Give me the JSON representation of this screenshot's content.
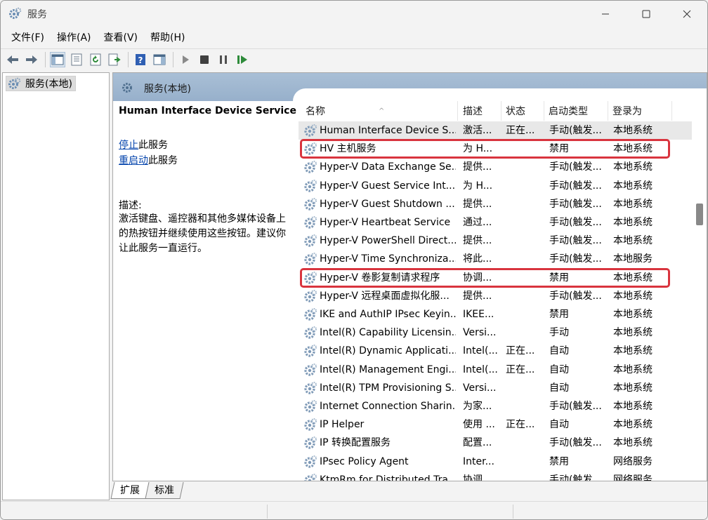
{
  "window": {
    "title": "服务"
  },
  "menu": [
    "文件(F)",
    "操作(A)",
    "查看(V)",
    "帮助(H)"
  ],
  "toolbar": {
    "icons": [
      "back-arrow-icon",
      "forward-arrow-icon",
      "show-hide-console-tree-icon",
      "properties-icon",
      "refresh-icon",
      "export-list-icon",
      "help-icon",
      "show-action-pane-icon",
      "start-service-icon",
      "stop-service-icon",
      "pause-service-icon",
      "restart-service-icon"
    ]
  },
  "tree": {
    "item_label": "服务(本地)"
  },
  "main": {
    "header_title": "服务(本地)",
    "selected_service": "Human Interface Device Service",
    "stop_link": "停止",
    "stop_suffix": "此服务",
    "restart_link": "重启动",
    "restart_suffix": "此服务",
    "desc_label": "描述:",
    "desc_text": "激活键盘、遥控器和其他多媒体设备上的热按钮并继续使用这些按钮。建议你让此服务一直运行。"
  },
  "table": {
    "columns": [
      "名称",
      "描述",
      "状态",
      "启动类型",
      "登录为"
    ],
    "rows": [
      {
        "name": "Human Interface Device S...",
        "desc": "激活...",
        "status": "正在...",
        "startup": "手动(触发...",
        "logon": "本地系统",
        "selected": true
      },
      {
        "name": "HV 主机服务",
        "desc": "为 H...",
        "status": "",
        "startup": "禁用",
        "logon": "本地系统",
        "highlight": true
      },
      {
        "name": "Hyper-V Data Exchange Se...",
        "desc": "提供...",
        "status": "",
        "startup": "手动(触发...",
        "logon": "本地系统"
      },
      {
        "name": "Hyper-V Guest Service Int...",
        "desc": "为 H...",
        "status": "",
        "startup": "手动(触发...",
        "logon": "本地系统"
      },
      {
        "name": "Hyper-V Guest Shutdown ...",
        "desc": "提供...",
        "status": "",
        "startup": "手动(触发...",
        "logon": "本地系统"
      },
      {
        "name": "Hyper-V Heartbeat Service",
        "desc": "通过...",
        "status": "",
        "startup": "手动(触发...",
        "logon": "本地系统"
      },
      {
        "name": "Hyper-V PowerShell Direct...",
        "desc": "提供...",
        "status": "",
        "startup": "手动(触发...",
        "logon": "本地系统"
      },
      {
        "name": "Hyper-V Time Synchroniza...",
        "desc": "将此...",
        "status": "",
        "startup": "手动(触发...",
        "logon": "本地服务"
      },
      {
        "name": "Hyper-V 卷影复制请求程序",
        "desc": "协调...",
        "status": "",
        "startup": "禁用",
        "logon": "本地系统",
        "highlight": true
      },
      {
        "name": "Hyper-V 远程桌面虚拟化服...",
        "desc": "提供...",
        "status": "",
        "startup": "手动(触发...",
        "logon": "本地系统"
      },
      {
        "name": "IKE and AuthIP IPsec Keyin...",
        "desc": "IKEE...",
        "status": "",
        "startup": "禁用",
        "logon": "本地系统"
      },
      {
        "name": "Intel(R) Capability Licensin...",
        "desc": "Versi...",
        "status": "",
        "startup": "手动",
        "logon": "本地系统"
      },
      {
        "name": "Intel(R) Dynamic Applicati...",
        "desc": "Intel(...",
        "status": "正在...",
        "startup": "自动",
        "logon": "本地系统"
      },
      {
        "name": "Intel(R) Management Engi...",
        "desc": "Intel(...",
        "status": "正在...",
        "startup": "自动",
        "logon": "本地系统"
      },
      {
        "name": "Intel(R) TPM Provisioning S...",
        "desc": "Versi...",
        "status": "",
        "startup": "自动",
        "logon": "本地系统"
      },
      {
        "name": "Internet Connection Sharin...",
        "desc": "为家...",
        "status": "",
        "startup": "手动(触发...",
        "logon": "本地系统"
      },
      {
        "name": "IP Helper",
        "desc": "使用 ...",
        "status": "正在...",
        "startup": "自动",
        "logon": "本地系统"
      },
      {
        "name": "IP 转换配置服务",
        "desc": "配置...",
        "status": "",
        "startup": "手动(触发...",
        "logon": "本地系统"
      },
      {
        "name": "IPsec Policy Agent",
        "desc": "Inter...",
        "status": "",
        "startup": "禁用",
        "logon": "网络服务"
      },
      {
        "name": "KtmRm for Distributed Tra...",
        "desc": "协调...",
        "status": "",
        "startup": "手动(触发...",
        "logon": "网络服务"
      }
    ]
  },
  "tabs": [
    "扩展",
    "标准"
  ],
  "colors": {
    "highlight": "#d9343e",
    "header_bg": "#a9bfd6",
    "link": "#0645ad"
  }
}
